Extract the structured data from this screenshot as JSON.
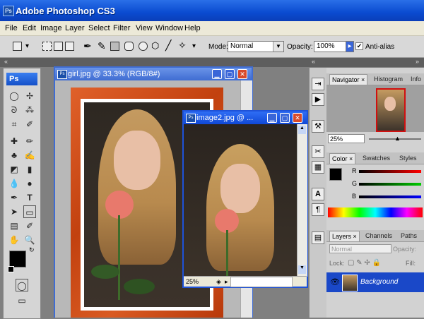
{
  "window": {
    "title": "Adobe Photoshop CS3",
    "logo": "Ps"
  },
  "menu": [
    "File",
    "Edit",
    "Image",
    "Layer",
    "Select",
    "Filter",
    "View",
    "Window",
    "Help"
  ],
  "options": {
    "mode_label": "Mode:",
    "mode_value": "Normal",
    "opacity_label": "Opacity:",
    "opacity_value": "100%",
    "antialias_label": "Anti-alias",
    "antialias_checked": true
  },
  "toolbox": {
    "logo": "Ps"
  },
  "documents": [
    {
      "title": "girl.jpg @ 33.3% (RGB/8#)"
    },
    {
      "title": "image2.jpg @ ...",
      "zoom": "25%"
    }
  ],
  "navigator": {
    "tabs": [
      "Navigator",
      "Histogram",
      "Info"
    ],
    "zoom": "25%"
  },
  "color_panel": {
    "tabs": [
      "Color",
      "Swatches",
      "Styles"
    ],
    "channels": [
      "R",
      "G",
      "B"
    ]
  },
  "layers_panel": {
    "tabs": [
      "Layers",
      "Channels",
      "Paths"
    ],
    "blend_mode": "Normal",
    "opacity_label": "Opacity:",
    "lock_label": "Lock:",
    "fill_label": "Fill:",
    "layer_name": "Background"
  },
  "colors": {
    "accent": "#0a4bd0",
    "selected_layer": "#1a48c8",
    "frame": "#d04e1c"
  }
}
